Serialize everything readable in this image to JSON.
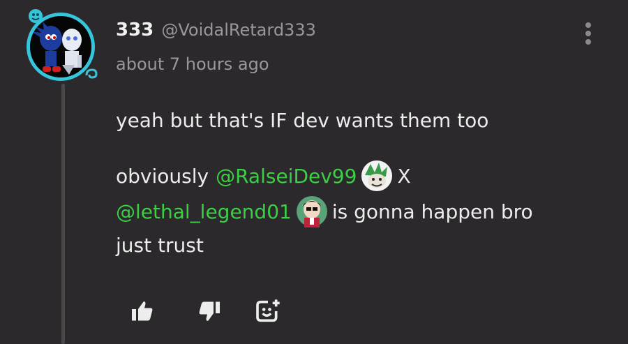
{
  "comment": {
    "display_name": "333",
    "handle": "@VoidalRetard333",
    "timestamp": "about 7 hours ago",
    "paragraph1": "yeah but that's IF dev wants them too",
    "line1_start": "obviously",
    "mention1": "@RalseiDev99",
    "line1_end": "X",
    "mention2": "@lethal_legend01",
    "line2_end": "is gonna happen bro",
    "line3": "just trust"
  },
  "icons": {
    "menu": "more-vertical-icon",
    "like": "thumbs-up-icon",
    "dislike": "thumbs-down-icon",
    "react": "add-reaction-icon"
  },
  "colors": {
    "background": "#2b292b",
    "mention": "#3ccf45",
    "avatar_ring": "#35c6dc",
    "secondary_text": "#9a979a"
  }
}
